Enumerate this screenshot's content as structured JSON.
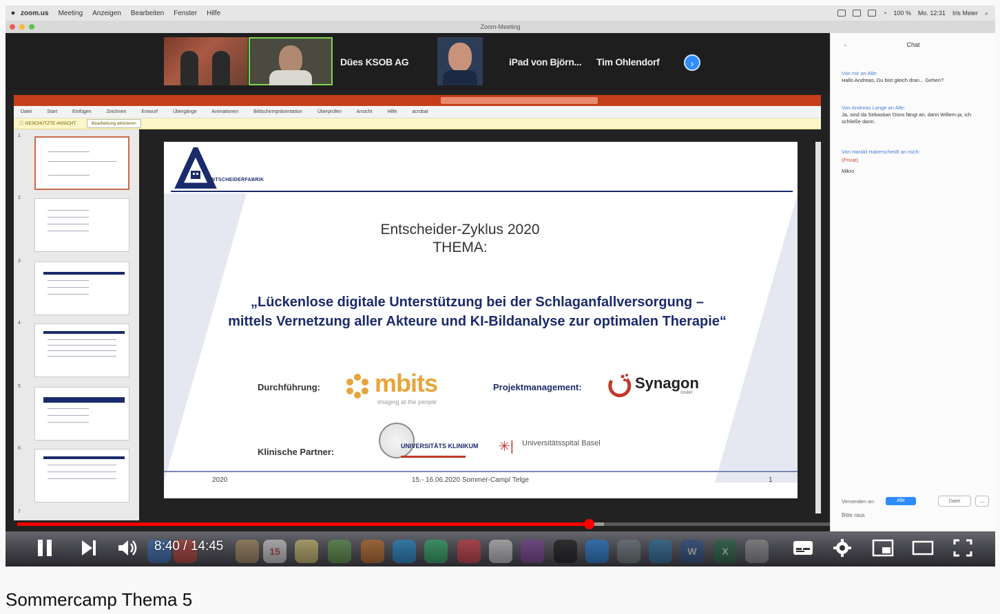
{
  "mac_menubar": {
    "app": "zoom.us",
    "menus": [
      "Meeting",
      "Anzeigen",
      "Bearbeiten",
      "Fenster",
      "Hilfe"
    ],
    "battery": "100 %",
    "clock": "Mo. 12:31",
    "user": "Iris Meier"
  },
  "zoom": {
    "window_title": "Zoom-Meeting",
    "participants": [
      {
        "name": "Dües KSOB AG"
      },
      {
        "name": "iPad von Björn..."
      },
      {
        "name": "Tim Ohlendorf"
      }
    ]
  },
  "ppt": {
    "tabs": [
      "Datei",
      "Start",
      "Einfügen",
      "Zeichnen",
      "Entwurf",
      "Übergänge",
      "Animationen",
      "Bildschirmpräsentation",
      "Überprüfen",
      "Ansicht",
      "Hilfe",
      "acrobat"
    ],
    "protected_view_label": "GESCHÜTZTE ANSICHT",
    "protected_view_button": "Bearbeitung aktivieren",
    "slide": {
      "logo_text": "ENTSCHEIDERFABRIK",
      "event": "Entscheider-Zyklus 2020",
      "theme_label": "THEMA:",
      "title_line1": "„Lückenlose digitale Unterstützung bei der Schlaganfallversorgung –",
      "title_line2": "mittels Vernetzung aller Akteure und KI-Bildanalyse zur optimalen Therapie“",
      "label_execution": "Durchführung:",
      "label_project_mgmt": "Projektmanagement:",
      "label_clinical": "Klinische Partner:",
      "mbits_name": "mbits",
      "mbits_tagline": "imaging at the people",
      "synagon_name": "Synagon",
      "synagon_sub": "GmbH",
      "uk_name": "UNIVERSITÄTS KLINIKUM",
      "usb_name": "Universitätsspital Basel",
      "footer_year": "2020",
      "footer_date": "15.- 16.06.2020 Sommer-Camp/ Telge",
      "page_number": "1"
    },
    "thumbnail_numbers": [
      "1",
      "2",
      "3",
      "4",
      "5",
      "6",
      "7"
    ]
  },
  "chat": {
    "title": "Chat",
    "messages": [
      {
        "from": "Von mir an Alle:",
        "text": "Hallo Andreas, Du bist gleich dran... Gehen?"
      },
      {
        "from": "Von Andreas Lange an Alle:",
        "text": "Ja, sind da Sebastian Düns fängt an, dann Willem-ja, ich schließe dann."
      },
      {
        "from": "Von Harald Haberscheidt an mich:",
        "private": "(Privat)",
        "text": "Mikro"
      }
    ],
    "to_label": "Versenden an:",
    "to_value": "Alle",
    "file_button": "Datei",
    "input_placeholder": "Bitte raus"
  },
  "youtube": {
    "current_time": "8:40",
    "duration": "14:45",
    "time_display": "8:40 / 14:45",
    "progress_played": 0.588,
    "progress_buffered": 0.604,
    "video_title": "Sommercamp Thema 5"
  },
  "colors": {
    "accent_red": "#ff0000",
    "ppt_orange": "#c43e1c",
    "slide_navy": "#1b2a6b",
    "zoom_blue": "#2d8cff"
  }
}
